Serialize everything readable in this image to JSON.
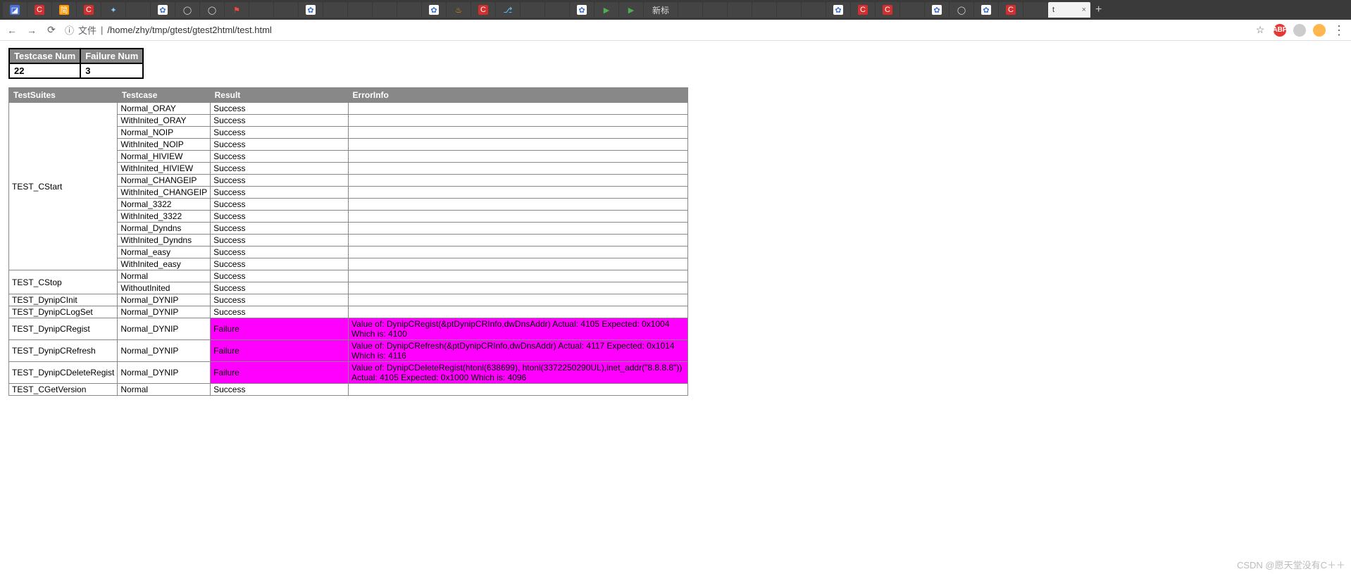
{
  "browser": {
    "active_tab_label": "t",
    "new_tab_label": "新标",
    "back": "←",
    "forward": "→",
    "reload": "⟳",
    "info": "ⓘ",
    "url_prefix": "文件",
    "url_path": "/home/zhy/tmp/gtest/gtest2html/test.html",
    "star": "☆",
    "abp": "ABP",
    "menu": "⋮",
    "close": "×"
  },
  "summary": {
    "headers": [
      "Testcase Num",
      "Failure Num"
    ],
    "values": [
      "22",
      "3"
    ]
  },
  "thead": {
    "suite": "TestSuites",
    "case": "Testcase",
    "result": "Result",
    "error": "ErrorInfo"
  },
  "suites": [
    {
      "name": "TEST_CStart",
      "cases": [
        {
          "name": "Normal_ORAY",
          "result": "Success",
          "error": "",
          "fail": false
        },
        {
          "name": "WithInited_ORAY",
          "result": "Success",
          "error": "",
          "fail": false
        },
        {
          "name": "Normal_NOIP",
          "result": "Success",
          "error": "",
          "fail": false
        },
        {
          "name": "WithInited_NOIP",
          "result": "Success",
          "error": "",
          "fail": false
        },
        {
          "name": "Normal_HIVIEW",
          "result": "Success",
          "error": "",
          "fail": false
        },
        {
          "name": "WithInited_HIVIEW",
          "result": "Success",
          "error": "",
          "fail": false
        },
        {
          "name": "Normal_CHANGEIP",
          "result": "Success",
          "error": "",
          "fail": false
        },
        {
          "name": "WithInited_CHANGEIP",
          "result": "Success",
          "error": "",
          "fail": false
        },
        {
          "name": "Normal_3322",
          "result": "Success",
          "error": "",
          "fail": false
        },
        {
          "name": "WithInited_3322",
          "result": "Success",
          "error": "",
          "fail": false
        },
        {
          "name": "Normal_Dyndns",
          "result": "Success",
          "error": "",
          "fail": false
        },
        {
          "name": "WithInited_Dyndns",
          "result": "Success",
          "error": "",
          "fail": false
        },
        {
          "name": "Normal_easy",
          "result": "Success",
          "error": "",
          "fail": false
        },
        {
          "name": "WithInited_easy",
          "result": "Success",
          "error": "",
          "fail": false
        }
      ]
    },
    {
      "name": "TEST_CStop",
      "cases": [
        {
          "name": "Normal",
          "result": "Success",
          "error": "",
          "fail": false
        },
        {
          "name": "WithoutInited",
          "result": "Success",
          "error": "",
          "fail": false
        }
      ]
    },
    {
      "name": "TEST_DynipCInit",
      "cases": [
        {
          "name": "Normal_DYNIP",
          "result": "Success",
          "error": "",
          "fail": false
        }
      ]
    },
    {
      "name": "TEST_DynipCLogSet",
      "cases": [
        {
          "name": "Normal_DYNIP",
          "result": "Success",
          "error": "",
          "fail": false
        }
      ]
    },
    {
      "name": "TEST_DynipCRegist",
      "cases": [
        {
          "name": "Normal_DYNIP",
          "result": "Failure",
          "error": "Value of: DynipCRegist(&ptDynipCRInfo,dwDnsAddr) Actual: 4105 Expected: 0x1004 Which is: 4100",
          "fail": true
        }
      ]
    },
    {
      "name": "TEST_DynipCRefresh",
      "cases": [
        {
          "name": "Normal_DYNIP",
          "result": "Failure",
          "error": "Value of: DynipCRefresh(&ptDynipCRInfo,dwDnsAddr) Actual: 4117 Expected: 0x1014 Which is: 4116",
          "fail": true
        }
      ]
    },
    {
      "name": "TEST_DynipCDeleteRegist",
      "cases": [
        {
          "name": "Normal_DYNIP",
          "result": "Failure",
          "error": "Value of: DynipCDeleteRegist(htonl(638699), htonl(3372250290UL),inet_addr(\"8.8.8.8\")) Actual: 4105 Expected: 0x1000 Which is: 4096",
          "fail": true
        }
      ]
    },
    {
      "name": "TEST_CGetVersion",
      "cases": [
        {
          "name": "Normal",
          "result": "Success",
          "error": "",
          "fail": false
        }
      ]
    }
  ],
  "tab_icons": [
    {
      "bg": "#4a6fd4",
      "fg": "#fff",
      "ch": "◪"
    },
    {
      "bg": "#d32f2f",
      "fg": "#fff",
      "ch": "C"
    },
    {
      "bg": "#ff9800",
      "fg": "#fff",
      "ch": "简"
    },
    {
      "bg": "#d32f2f",
      "fg": "#fff",
      "ch": "C"
    },
    {
      "bg": "#444",
      "fg": "#8cf",
      "ch": "✦"
    },
    {
      "bg": "#444",
      "fg": "#aaa",
      "ch": ""
    },
    {
      "bg": "#fff",
      "fg": "#3b6fd6",
      "ch": "✿"
    },
    {
      "bg": "#444",
      "fg": "#ddd",
      "ch": "◯"
    },
    {
      "bg": "#444",
      "fg": "#ddd",
      "ch": "◯"
    },
    {
      "bg": "#444",
      "fg": "#f44",
      "ch": "⚑"
    },
    {
      "bg": "#444",
      "fg": "#aaa",
      "ch": ""
    },
    {
      "bg": "#444",
      "fg": "#aaa",
      "ch": ""
    },
    {
      "bg": "#fff",
      "fg": "#3b6fd6",
      "ch": "✿"
    },
    {
      "bg": "#444",
      "fg": "#aaa",
      "ch": ""
    },
    {
      "bg": "#444",
      "fg": "#aaa",
      "ch": ""
    },
    {
      "bg": "#444",
      "fg": "#aaa",
      "ch": ""
    },
    {
      "bg": "#444",
      "fg": "#aaa",
      "ch": ""
    },
    {
      "bg": "#fff",
      "fg": "#3b6fd6",
      "ch": "✿"
    },
    {
      "bg": "#444",
      "fg": "#f90",
      "ch": "♨"
    },
    {
      "bg": "#d32f2f",
      "fg": "#fff",
      "ch": "C"
    },
    {
      "bg": "#444",
      "fg": "#6cf",
      "ch": "⎇"
    },
    {
      "bg": "#444",
      "fg": "#aaa",
      "ch": ""
    },
    {
      "bg": "#444",
      "fg": "#aaa",
      "ch": ""
    },
    {
      "bg": "#fff",
      "fg": "#3b6fd6",
      "ch": "✿"
    },
    {
      "bg": "#444",
      "fg": "#4caf50",
      "ch": "▶"
    },
    {
      "bg": "#444",
      "fg": "#4caf50",
      "ch": "▶"
    },
    {
      "bg": "label",
      "fg": "",
      "ch": "新标"
    },
    {
      "bg": "#444",
      "fg": "#aaa",
      "ch": ""
    },
    {
      "bg": "#444",
      "fg": "#aaa",
      "ch": ""
    },
    {
      "bg": "#444",
      "fg": "#aaa",
      "ch": ""
    },
    {
      "bg": "#444",
      "fg": "#aaa",
      "ch": ""
    },
    {
      "bg": "#444",
      "fg": "#aaa",
      "ch": ""
    },
    {
      "bg": "#444",
      "fg": "#aaa",
      "ch": ""
    },
    {
      "bg": "#fff",
      "fg": "#3b6fd6",
      "ch": "✿"
    },
    {
      "bg": "#d32f2f",
      "fg": "#fff",
      "ch": "C"
    },
    {
      "bg": "#d32f2f",
      "fg": "#fff",
      "ch": "C"
    },
    {
      "bg": "#444",
      "fg": "#aaa",
      "ch": ""
    },
    {
      "bg": "#fff",
      "fg": "#3b6fd6",
      "ch": "✿"
    },
    {
      "bg": "#444",
      "fg": "#ddd",
      "ch": "◯"
    },
    {
      "bg": "#fff",
      "fg": "#3b6fd6",
      "ch": "✿"
    },
    {
      "bg": "#d32f2f",
      "fg": "#fff",
      "ch": "C"
    },
    {
      "bg": "#444",
      "fg": "#aaa",
      "ch": ""
    }
  ],
  "watermark": "CSDN @愿天堂没有C＋＋"
}
